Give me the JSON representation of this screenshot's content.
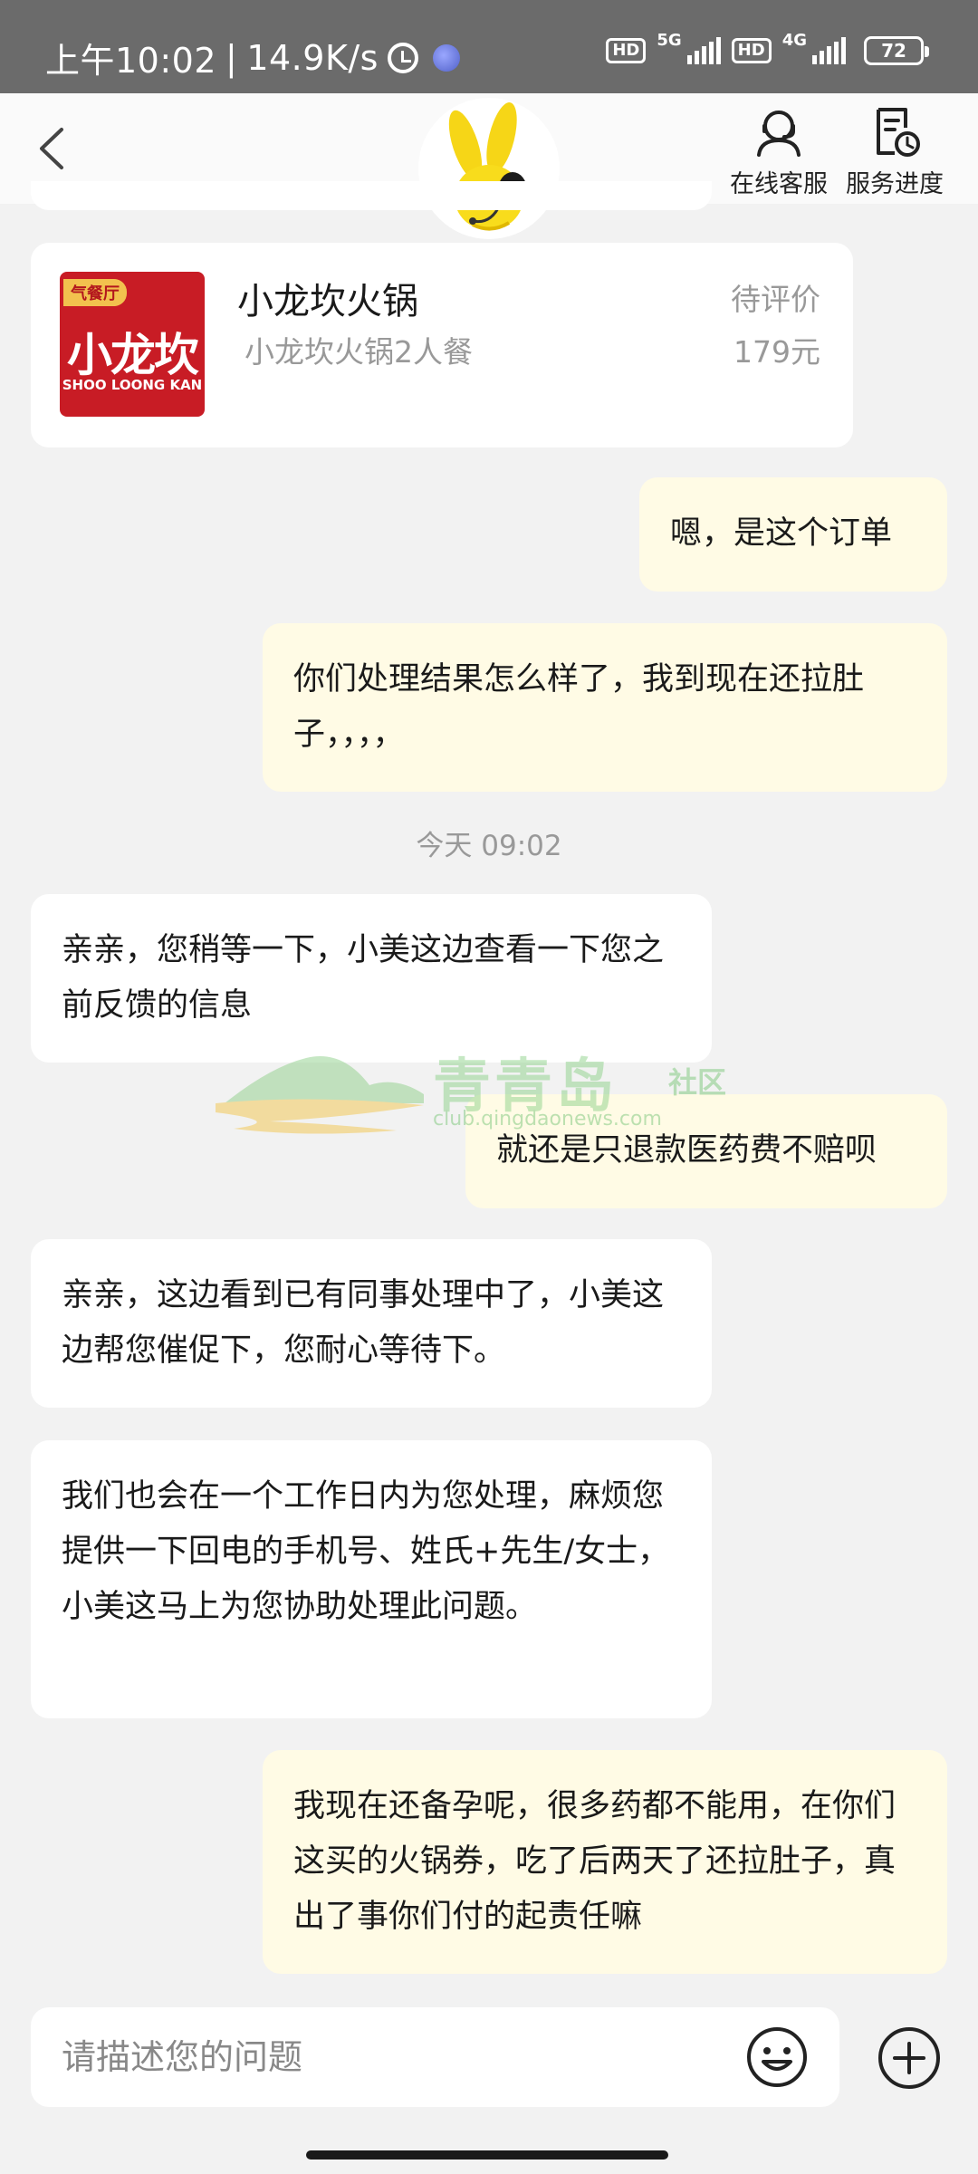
{
  "status_bar": {
    "time": "上午10:02",
    "separator": "|",
    "net_speed": "14.9K/s",
    "sim1_tag": "HD",
    "sim1_net": "5G",
    "sim2_tag": "HD",
    "sim2_net": "4G",
    "battery": "72"
  },
  "header": {
    "back_icon": "chevron-left-icon",
    "mascot_icon": "yellow-rabbit-mascot-icon",
    "online_service_label": "在线客服",
    "service_progress_label": "服务进度"
  },
  "order_card": {
    "logo_tag": "气餐厅",
    "logo_main": "小龙坎",
    "logo_sub": "SHOO LOONG KAN",
    "shop_name": "小龙坎火锅",
    "item_name": "小龙坎火锅2人餐",
    "status": "待评价",
    "price": "179元"
  },
  "messages": [
    {
      "side": "out",
      "text": "嗯，是这个订单"
    },
    {
      "side": "out",
      "text": "你们处理结果怎么样了，我到现在还拉肚子，，，，"
    },
    {
      "side": "in",
      "text": "亲亲，您稍等一下，小美这边查看一下您之前反馈的信息"
    },
    {
      "side": "out",
      "text": "就还是只退款医药费不赔呗"
    },
    {
      "side": "in",
      "text": "亲亲，这边看到已有同事处理中了，小美这边帮您催促下，您耐心等待下。"
    },
    {
      "side": "in",
      "text": "我们也会在一个工作日内为您处理，麻烦您提供一下回电的手机号、姓氏+先生/女士，小美这马上为您协助处理此问题。"
    },
    {
      "side": "out",
      "text": "我现在还备孕呢，很多药都不能用，在你们这买的火锅券，吃了后两天了还拉肚子，真出了事你们付的起责任嘛"
    }
  ],
  "timestamp": "今天 09:02",
  "watermark": {
    "text": "青青岛",
    "tag": "社区",
    "url": "club.qingdaonews.com"
  },
  "input": {
    "placeholder": "请描述您的问题",
    "emoji_icon": "smiley-face-icon",
    "plus_icon": "plus-circle-icon"
  },
  "colors": {
    "status_bar_bg": "#6b6b6b",
    "page_bg": "#f2f2f2",
    "incoming_bubble": "#ffffff",
    "outgoing_bubble": "#fffbe5",
    "logo_red": "#c81c25",
    "muted_text": "#999999"
  }
}
